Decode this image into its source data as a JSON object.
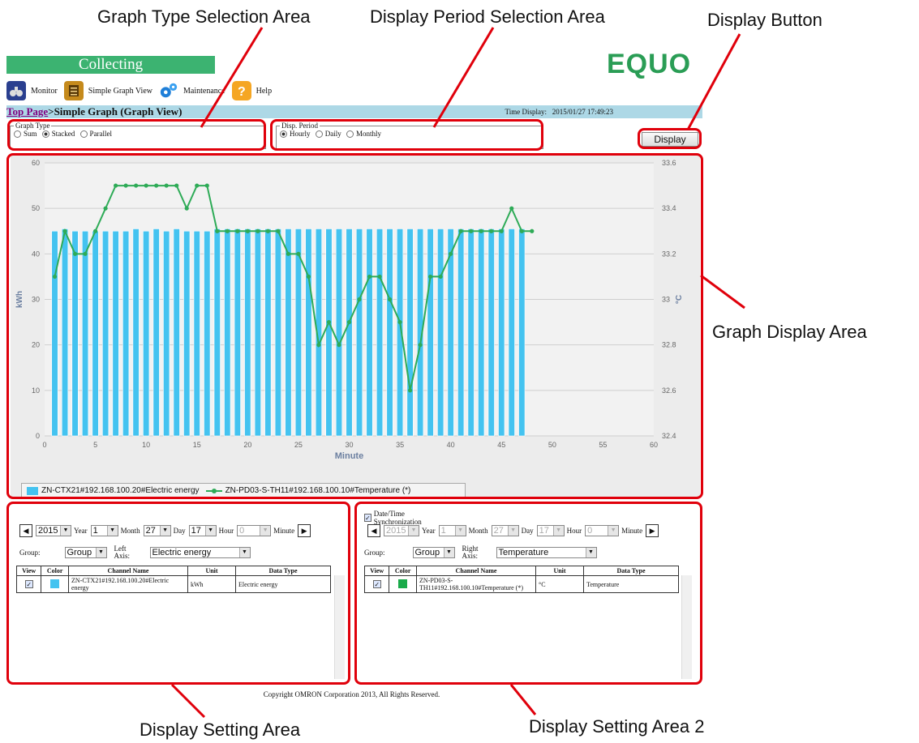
{
  "callouts": {
    "graph_type_area": "Graph Type Selection Area",
    "display_period_area": "Display Period Selection Area",
    "display_button": "Display Button",
    "graph_display_area": "Graph Display Area",
    "display_setting_area": "Display Setting Area",
    "display_setting_area_2": "Display Setting Area 2"
  },
  "app": {
    "status": "Collecting",
    "logo": "EQUO",
    "menu": [
      {
        "label": "Monitor",
        "icon": "binoculars-icon"
      },
      {
        "label": "Simple Graph View",
        "icon": "graph-icon"
      },
      {
        "label": "Maintenance",
        "icon": "gears-icon"
      },
      {
        "label": "Help",
        "icon": "help-icon"
      }
    ],
    "breadcrumb_link": "Top Page",
    "breadcrumb_current": ">Simple Graph (Graph View)",
    "time_display_label": "Time Display:",
    "time_display_value": "2015/01/27 17:49:23"
  },
  "graph_type": {
    "legend": "Graph Type",
    "options": [
      "Sum",
      "Stacked",
      "Parallel"
    ],
    "selected": "Stacked"
  },
  "disp_period": {
    "legend": "Disp. Period",
    "options": [
      "Hourly",
      "Daily",
      "Monthly"
    ],
    "selected": "Hourly"
  },
  "display_button": "Display",
  "chart_data": {
    "type": "bar",
    "xlabel": "Minute",
    "ylabel": "kWh",
    "y2label": "°C",
    "xlim": [
      0,
      60
    ],
    "ylim": [
      0,
      60
    ],
    "y2lim": [
      32.4,
      33.6
    ],
    "x_ticks": [
      0,
      5,
      10,
      15,
      20,
      25,
      30,
      35,
      40,
      45,
      50,
      55,
      60
    ],
    "y_ticks": [
      0,
      10,
      20,
      30,
      40,
      50,
      60
    ],
    "y2_ticks": [
      "32.4",
      "32.6",
      "32.8",
      "33",
      "33.2",
      "33.4",
      "33.6"
    ],
    "grid": true,
    "legend_position": "bottom-left",
    "colors": {
      "bar": "#44c3f0",
      "line": "#2eab57"
    },
    "series": [
      {
        "name": "ZN-CTX21#192.168.100.20#Electric energy",
        "type": "bar",
        "axis": "left",
        "x": [
          1,
          2,
          3,
          4,
          5,
          6,
          7,
          8,
          9,
          10,
          11,
          12,
          13,
          14,
          15,
          16,
          17,
          18,
          19,
          20,
          21,
          22,
          23,
          24,
          25,
          26,
          27,
          28,
          29,
          30,
          31,
          32,
          33,
          34,
          35,
          36,
          37,
          38,
          39,
          40,
          41,
          42,
          43,
          44,
          45,
          46,
          47
        ],
        "values": [
          45,
          45.5,
          45,
          45,
          45,
          45,
          45,
          45,
          45.5,
          45,
          45.5,
          45,
          45.5,
          45,
          45,
          45,
          45.5,
          45.5,
          45.5,
          45.5,
          45.5,
          45.5,
          45.5,
          45.5,
          45.5,
          45.5,
          45.5,
          45.5,
          45.5,
          45.5,
          45.5,
          45.5,
          45.5,
          45.5,
          45.5,
          45.5,
          45.5,
          45.5,
          45.5,
          45.5,
          45.5,
          45.5,
          45.5,
          45.5,
          45.5,
          45.5,
          45.5
        ]
      },
      {
        "name": "ZN-PD03-S-TH11#192.168.100.10#Temperature (*)",
        "type": "line",
        "axis": "right",
        "x": [
          1,
          2,
          3,
          4,
          5,
          6,
          7,
          8,
          9,
          10,
          11,
          12,
          13,
          14,
          15,
          16,
          17,
          18,
          19,
          20,
          21,
          22,
          23,
          24,
          25,
          26,
          27,
          28,
          29,
          30,
          31,
          32,
          33,
          34,
          35,
          36,
          37,
          38,
          39,
          40,
          41,
          42,
          43,
          44,
          45,
          46,
          47,
          48
        ],
        "values": [
          33.1,
          33.3,
          33.2,
          33.2,
          33.3,
          33.4,
          33.5,
          33.5,
          33.5,
          33.5,
          33.5,
          33.5,
          33.5,
          33.4,
          33.5,
          33.5,
          33.3,
          33.3,
          33.3,
          33.3,
          33.3,
          33.3,
          33.3,
          33.2,
          33.2,
          33.1,
          32.8,
          32.9,
          32.8,
          32.9,
          33.0,
          33.1,
          33.1,
          33.0,
          32.9,
          32.6,
          32.8,
          33.1,
          33.1,
          33.2,
          33.3,
          33.3,
          33.3,
          33.3,
          33.3,
          33.4,
          33.3,
          33.3
        ]
      }
    ]
  },
  "legend": {
    "bar_label": "ZN-CTX21#192.168.100.20#Electric energy",
    "line_label": "ZN-PD03-S-TH11#192.168.100.10#Temperature (*)"
  },
  "left_panel": {
    "year": "2015",
    "year_label": "Year",
    "month": "1",
    "month_label": "Month",
    "day": "27",
    "day_label": "Day",
    "hour": "17",
    "hour_label": "Hour",
    "minute": "0",
    "minute_label": "Minute",
    "group_label": "Group:",
    "group_value": "Group",
    "axis_label": "Left Axis:",
    "axis_value": "Electric energy",
    "columns": [
      "View",
      "Color",
      "Channel Name",
      "Unit",
      "Data Type"
    ],
    "rows": [
      {
        "checked": true,
        "color": "#44c3f0",
        "channel": "ZN-CTX21#192.168.100.20#Electric energy",
        "unit": "kWh",
        "data_type": "Electric energy"
      }
    ]
  },
  "right_panel": {
    "sync_label": "Date/Time Synchronization",
    "year": "2015",
    "year_label": "Year",
    "month": "1",
    "month_label": "Month",
    "day": "27",
    "day_label": "Day",
    "hour": "17",
    "hour_label": "Hour",
    "minute": "0",
    "minute_label": "Minute",
    "group_label": "Group:",
    "group_value": "Group",
    "axis_label": "Right Axis:",
    "axis_value": "Temperature",
    "columns": [
      "View",
      "Color",
      "Channel Name",
      "Unit",
      "Data Type"
    ],
    "rows": [
      {
        "checked": true,
        "color": "#1aaa4a",
        "channel": "ZN-PD03-S-TH11#192.168.100.10#Temperature (*)",
        "unit": "°C",
        "data_type": "Temperature"
      }
    ]
  },
  "copyright": "Copyright OMRON Corporation 2013, All Rights Reserved."
}
